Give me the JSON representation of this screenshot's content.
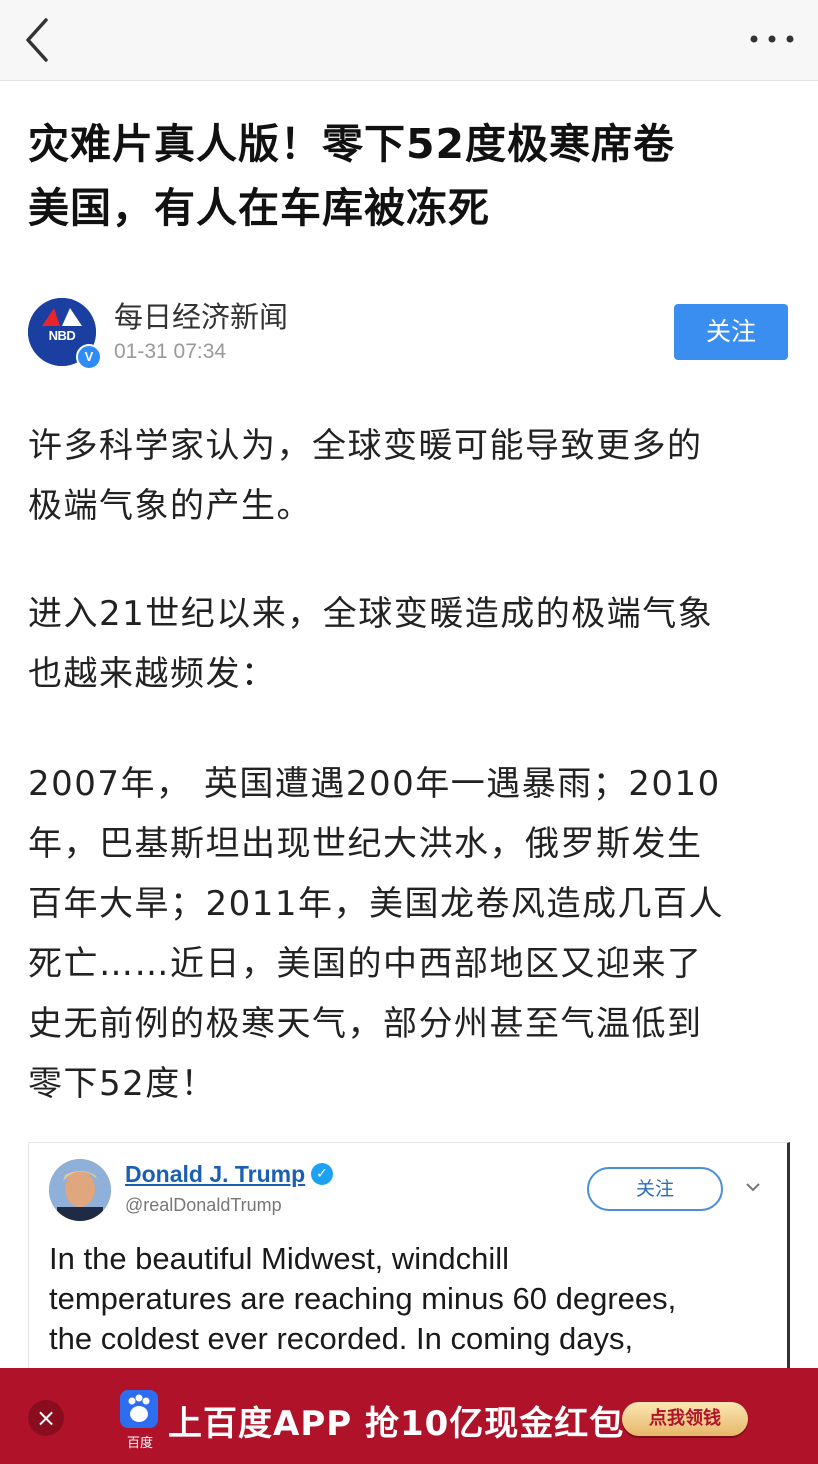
{
  "nav": {
    "back_icon": "back-chevron-icon",
    "more_icon": "more-dots-icon"
  },
  "article": {
    "title_line1": "灾难片真人版！零下52度极寒席卷",
    "title_line2": "美国，有人在车库被冻死",
    "author": {
      "name": "每日经济新闻",
      "time": "01-31 07:34",
      "logo_text": "NBD",
      "verified_mark": "V",
      "follow_label": "关注"
    },
    "paragraphs": [
      [
        "许多科学家认为，全球变暖可能导致更多的",
        "极端气象的产生。"
      ],
      [
        "进入21世纪以来，全球变暖造成的极端气象",
        "也越来越频发："
      ],
      [
        "2007年， 英国遭遇200年一遇暴雨；2010",
        "年，巴基斯坦出现世纪大洪水，俄罗斯发生",
        "百年大旱；2011年，美国龙卷风造成几百人",
        "死亡……近日，美国的中西部地区又迎来了",
        "史无前例的极寒天气，部分州甚至气温低到",
        "零下52度！"
      ]
    ]
  },
  "tweet": {
    "name": "Donald J. Trump",
    "handle": "@realDonaldTrump",
    "follow_label": "关注",
    "text": [
      "In the beautiful Midwest, windchill",
      "temperatures are reaching minus 60 degrees,",
      "the coldest ever recorded. In coming days,"
    ]
  },
  "banner": {
    "close_symbol": "×",
    "logo_label": "百度",
    "text": "上百度APP 抢10亿现金红包",
    "cta_label": "点我领钱",
    "background_color": "#b0122a"
  },
  "colors": {
    "accent": "#3a8ef0",
    "link": "#1b5fb4"
  }
}
